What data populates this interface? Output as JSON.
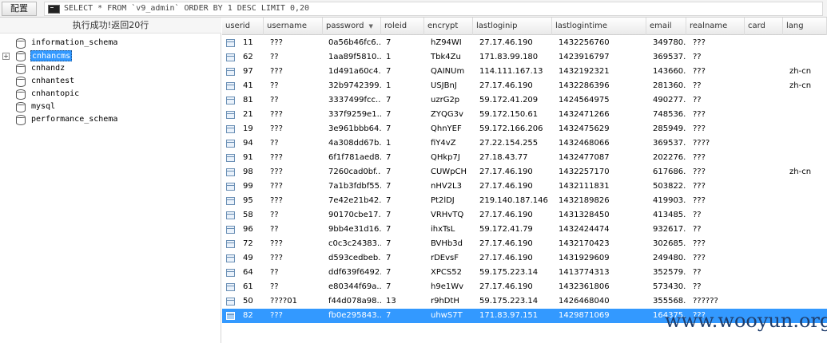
{
  "toolbar": {
    "config_label": "配置",
    "sql_query": "SELECT * FROM `v9_admin` ORDER BY 1 DESC LIMIT 0,20"
  },
  "left_panel": {
    "status": "执行成功!返回20行",
    "databases": [
      {
        "name": "information_schema"
      },
      {
        "name": "cnhancms"
      },
      {
        "name": "cnhandz"
      },
      {
        "name": "cnhantest"
      },
      {
        "name": "cnhantopic"
      },
      {
        "name": "mysql"
      },
      {
        "name": "performance_schema"
      }
    ]
  },
  "grid": {
    "columns": [
      "userid",
      "username",
      "password",
      "roleid",
      "encrypt",
      "lastloginip",
      "lastlogintime",
      "email",
      "realname",
      "card",
      "lang"
    ],
    "rows": [
      [
        "11",
        "???",
        "0a56b46fc6...",
        "7",
        "hZ94WI",
        "27.17.46.190",
        "1432256760",
        "349780...",
        "???",
        "",
        ""
      ],
      [
        "62",
        "??",
        "1aa89f5810...",
        "1",
        "Tbk4Zu",
        "171.83.99.180",
        "1423916797",
        "369537...",
        "??",
        "",
        ""
      ],
      [
        "97",
        "???",
        "1d491a60c4...",
        "7",
        "QAINUm",
        "114.111.167.13",
        "1432192321",
        "143660...",
        "???",
        "",
        "zh-cn"
      ],
      [
        "41",
        "??",
        "32b9742399...",
        "1",
        "USJBnJ",
        "27.17.46.190",
        "1432286396",
        "281360...",
        "??",
        "",
        "zh-cn"
      ],
      [
        "81",
        "??",
        "3337499fcc...",
        "7",
        "uzrG2p",
        "59.172.41.209",
        "1424564975",
        "490277...",
        "??",
        "",
        ""
      ],
      [
        "21",
        "???",
        "337f9259e1...",
        "7",
        "ZYQG3v",
        "59.172.150.61",
        "1432471266",
        "748536...",
        "???",
        "",
        ""
      ],
      [
        "19",
        "???",
        "3e961bbb64...",
        "7",
        "QhnYEF",
        "59.172.166.206",
        "1432475629",
        "285949...",
        "???",
        "",
        ""
      ],
      [
        "94",
        "??",
        "4a308dd67b...",
        "1",
        "fiY4vZ",
        "27.22.154.255",
        "1432468066",
        "369537...",
        "????",
        "",
        ""
      ],
      [
        "91",
        "???",
        "6f1f781aed8...",
        "7",
        "QHkp7J",
        "27.18.43.77",
        "1432477087",
        "202276...",
        "???",
        "",
        ""
      ],
      [
        "98",
        "???",
        "7260cad0bf...",
        "7",
        "CUWpCH",
        "27.17.46.190",
        "1432257170",
        "617686...",
        "???",
        "",
        "zh-cn"
      ],
      [
        "99",
        "???",
        "7a1b3fdbf55...",
        "7",
        "nHV2L3",
        "27.17.46.190",
        "1432111831",
        "503822...",
        "???",
        "",
        ""
      ],
      [
        "95",
        "???",
        "7e42e21b42...",
        "7",
        "Pt2lDJ",
        "219.140.187.146",
        "1432189826",
        "419903...",
        "???",
        "",
        ""
      ],
      [
        "58",
        "??",
        "90170cbe17...",
        "7",
        "VRHvTQ",
        "27.17.46.190",
        "1431328450",
        "413485...",
        "??",
        "",
        ""
      ],
      [
        "96",
        "??",
        "9bb4e31d16...",
        "7",
        "ihxTsL",
        "59.172.41.79",
        "1432424474",
        "932617...",
        "??",
        "",
        ""
      ],
      [
        "72",
        "???",
        "c0c3c24383...",
        "7",
        "BVHb3d",
        "27.17.46.190",
        "1432170423",
        "302685...",
        "???",
        "",
        ""
      ],
      [
        "49",
        "???",
        "d593cedbeb...",
        "7",
        "rDEvsF",
        "27.17.46.190",
        "1431929609",
        "249480...",
        "???",
        "",
        ""
      ],
      [
        "64",
        "??",
        "ddf639f6492...",
        "7",
        "XPCS52",
        "59.175.223.14",
        "1413774313",
        "352579...",
        "??",
        "",
        ""
      ],
      [
        "61",
        "??",
        "e80344f69a...",
        "7",
        "h9e1Wv",
        "27.17.46.190",
        "1432361806",
        "573430...",
        "??",
        "",
        ""
      ],
      [
        "50",
        "????01",
        "f44d078a98...",
        "13",
        "r9hDtH",
        "59.175.223.14",
        "1426468040",
        "355568...",
        "??????",
        "",
        ""
      ],
      [
        "82",
        "???",
        "fb0e295843...",
        "7",
        "uhwS7T",
        "171.83.97.151",
        "1429871069",
        "164375...",
        "???",
        "",
        ""
      ]
    ]
  },
  "watermark": "www.wooyun.org"
}
